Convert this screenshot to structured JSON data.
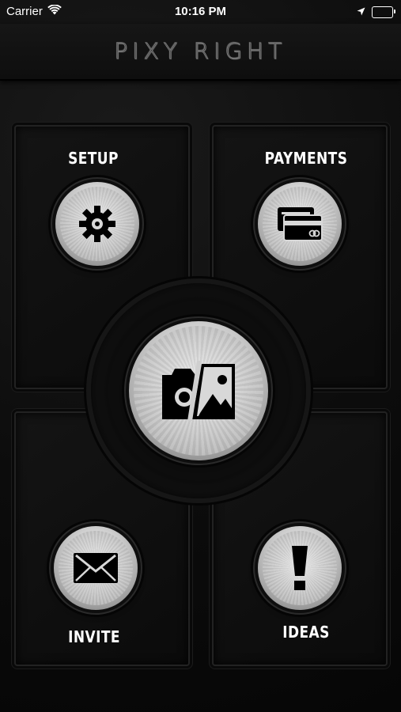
{
  "status_bar": {
    "carrier": "Carrier",
    "time": "10:16 PM",
    "wifi_icon": "wifi-icon",
    "location_icon": "location-arrow-icon",
    "battery_icon": "battery-icon"
  },
  "header": {
    "title": "PIXY RIGHT"
  },
  "menu": {
    "setup": {
      "label": "SETUP",
      "icon": "gear-icon"
    },
    "payments": {
      "label": "PAYMENTS",
      "icon": "credit-card-icon"
    },
    "camera": {
      "icon": "camera-photo-icon"
    },
    "invite": {
      "label": "INVITE",
      "icon": "envelope-icon"
    },
    "ideas": {
      "label": "IDEAS",
      "icon": "exclamation-icon"
    }
  },
  "colors": {
    "background": "#0c0c0c",
    "metal": "#d5d5d5",
    "text": "#ffffff"
  }
}
